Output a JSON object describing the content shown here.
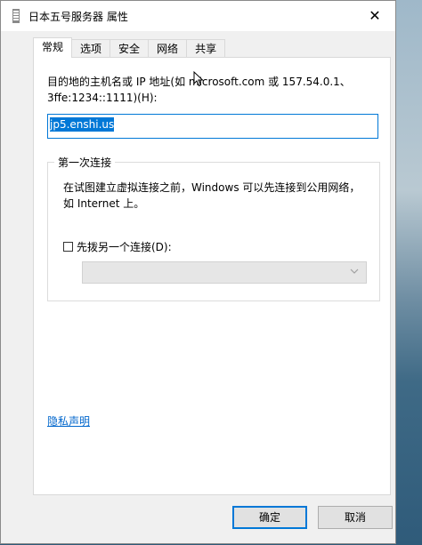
{
  "window": {
    "title": "日本五号服务器 属性",
    "close_glyph": "✕"
  },
  "tabs": [
    {
      "label": "常规",
      "active": true
    },
    {
      "label": "选项",
      "active": false
    },
    {
      "label": "安全",
      "active": false
    },
    {
      "label": "网络",
      "active": false
    },
    {
      "label": "共享",
      "active": false
    }
  ],
  "general": {
    "host_description": "目的地的主机名或 IP 地址(如 microsoft.com 或 157.54.0.1、3ffe:1234::1111)(H):",
    "host_value": "jp5.enshi.us",
    "first_connect": {
      "title": "第一次连接",
      "text": "在试图建立虚拟连接之前，Windows 可以先连接到公用网络，如 Internet 上。",
      "checkbox_label": "先拨另一个连接(D):",
      "checkbox_checked": false,
      "select_value": "",
      "select_enabled": false
    },
    "privacy_link": "隐私声明"
  },
  "buttons": {
    "ok": "确定",
    "cancel": "取消"
  },
  "icons": {
    "title_icon": "vpn-connection-icon",
    "dropdown_icon": "chevron-down-icon",
    "close_icon": "close-icon"
  },
  "colors": {
    "accent": "#0078d7",
    "link": "#0066cc",
    "window_bg": "#f0f0f0",
    "panel_bg": "#ffffff"
  }
}
